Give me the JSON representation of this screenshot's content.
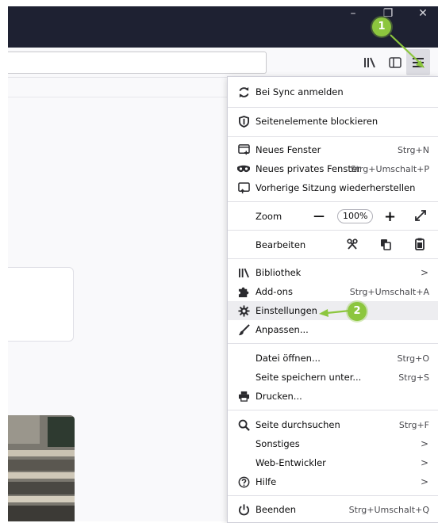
{
  "window": {
    "minimize": "–",
    "restore": "❐",
    "close": "✕"
  },
  "toolbar": {
    "library_icon": "library-icon",
    "sidebar_icon": "sidebar-icon",
    "menu_icon": "hamburger-menu-icon"
  },
  "menu": {
    "sync": {
      "label": "Bei Sync anmelden"
    },
    "block": {
      "label": "Seitenelemente blockieren"
    },
    "new_window": {
      "label": "Neues Fenster",
      "shortcut": "Strg+N"
    },
    "private_window": {
      "label": "Neues privates Fenster",
      "shortcut": "Strg+Umschalt+P"
    },
    "restore_session": {
      "label": "Vorherige Sitzung wiederherstellen"
    },
    "zoom": {
      "label": "Zoom",
      "minus": "—",
      "value": "100%",
      "plus": "+"
    },
    "edit": {
      "label": "Bearbeiten"
    },
    "library": {
      "label": "Bibliothek",
      "arrow": ">"
    },
    "addons": {
      "label": "Add-ons",
      "shortcut": "Strg+Umschalt+A"
    },
    "settings": {
      "label": "Einstellungen"
    },
    "customize": {
      "label": "Anpassen..."
    },
    "open_file": {
      "label": "Datei öffnen...",
      "shortcut": "Strg+O"
    },
    "save_page": {
      "label": "Seite speichern unter...",
      "shortcut": "Strg+S"
    },
    "print": {
      "label": "Drucken..."
    },
    "find": {
      "label": "Seite durchsuchen",
      "shortcut": "Strg+F"
    },
    "more": {
      "label": "Sonstiges",
      "arrow": ">"
    },
    "webdev": {
      "label": "Web-Entwickler",
      "arrow": ">"
    },
    "help": {
      "label": "Hilfe",
      "arrow": ">"
    },
    "quit": {
      "label": "Beenden",
      "shortcut": "Strg+Umschalt+Q"
    }
  },
  "annotations": {
    "step1": "1",
    "step2": "2"
  },
  "colors": {
    "titlebar": "#1e2132",
    "accent": "#8cc63e",
    "highlight": "#ededf0"
  }
}
